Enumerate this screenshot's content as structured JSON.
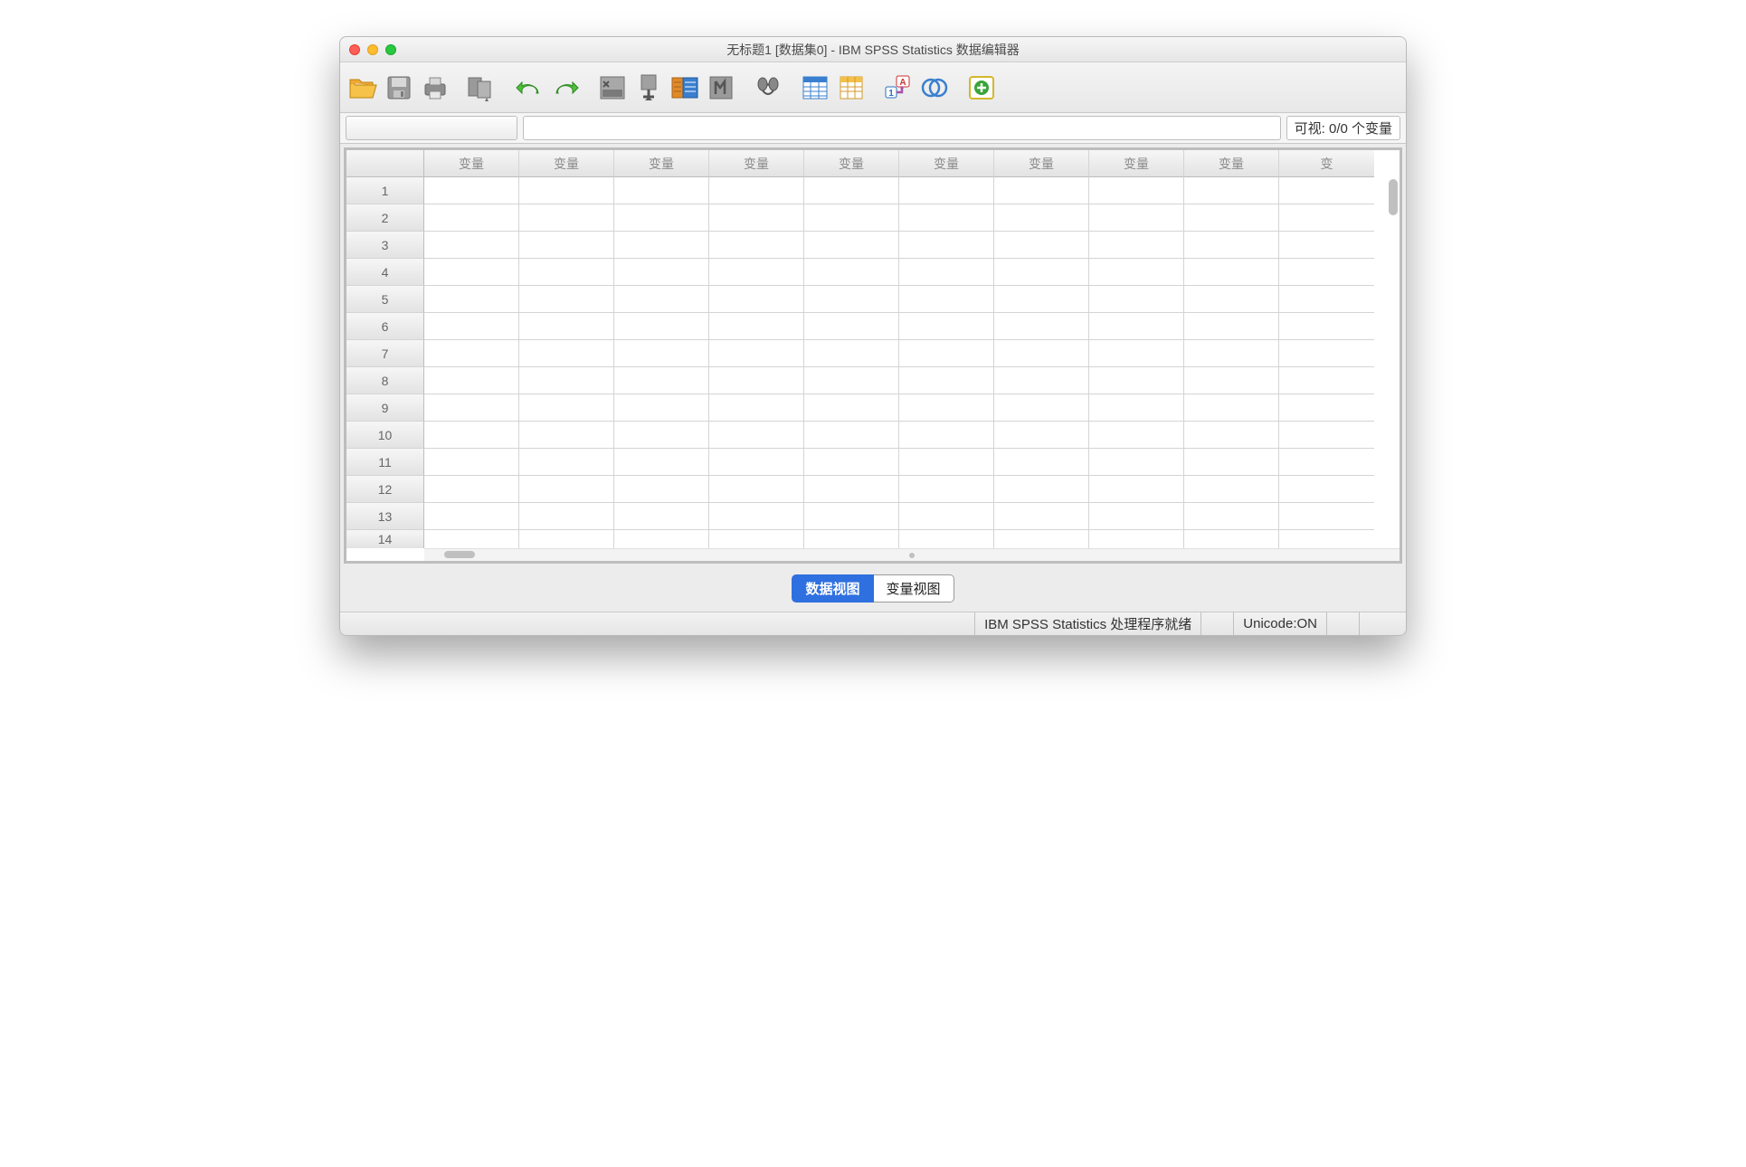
{
  "window": {
    "title": "无标题1 [数据集0] - IBM SPSS Statistics 数据编辑器"
  },
  "toolbar": {
    "open": "open-file-icon",
    "save": "save-icon",
    "print": "print-icon",
    "recall": "recall-dialog-icon",
    "undo": "undo-icon",
    "redo": "redo-icon",
    "goto_case": "goto-case-icon",
    "goto_var": "goto-variable-icon",
    "variables": "variables-icon",
    "run": "run-icon",
    "find": "find-icon",
    "split": "split-file-icon",
    "weight": "weight-cases-icon",
    "value_labels": "value-labels-icon",
    "use_sets": "use-sets-icon",
    "add": "add-icon"
  },
  "idbar": {
    "visible_label": "可视: 0/0 个变量"
  },
  "grid": {
    "column_header": "变量",
    "partial_header": "变",
    "rows": [
      1,
      2,
      3,
      4,
      5,
      6,
      7,
      8,
      9,
      10,
      11,
      12,
      13,
      14
    ]
  },
  "tabs": {
    "data_view": "数据视图",
    "variable_view": "变量视图"
  },
  "status": {
    "processor": "IBM SPSS Statistics 处理程序就绪",
    "unicode": "Unicode:ON"
  }
}
